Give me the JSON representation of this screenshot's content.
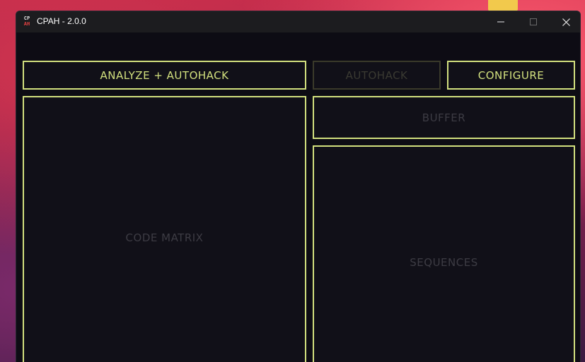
{
  "window": {
    "icon_top": "CP",
    "icon_bottom": "AH",
    "title": "CPAH - 2.0.0"
  },
  "controls": {
    "minimize": "minimize-icon",
    "maximize": "maximize-icon",
    "close": "close-icon"
  },
  "toolbar": {
    "analyze_label": "ANALYZE + AUTOHACK",
    "autohack_label": "AUTOHACK",
    "configure_label": "CONFIGURE"
  },
  "panels": {
    "code_matrix": "CODE MATRIX",
    "buffer": "BUFFER",
    "sequences": "SEQUENCES"
  },
  "colors": {
    "accent": "#d2e07e",
    "background": "#0d0c14",
    "placeholder_text": "#3d3c44",
    "titlebar": "#1c1c1f"
  }
}
